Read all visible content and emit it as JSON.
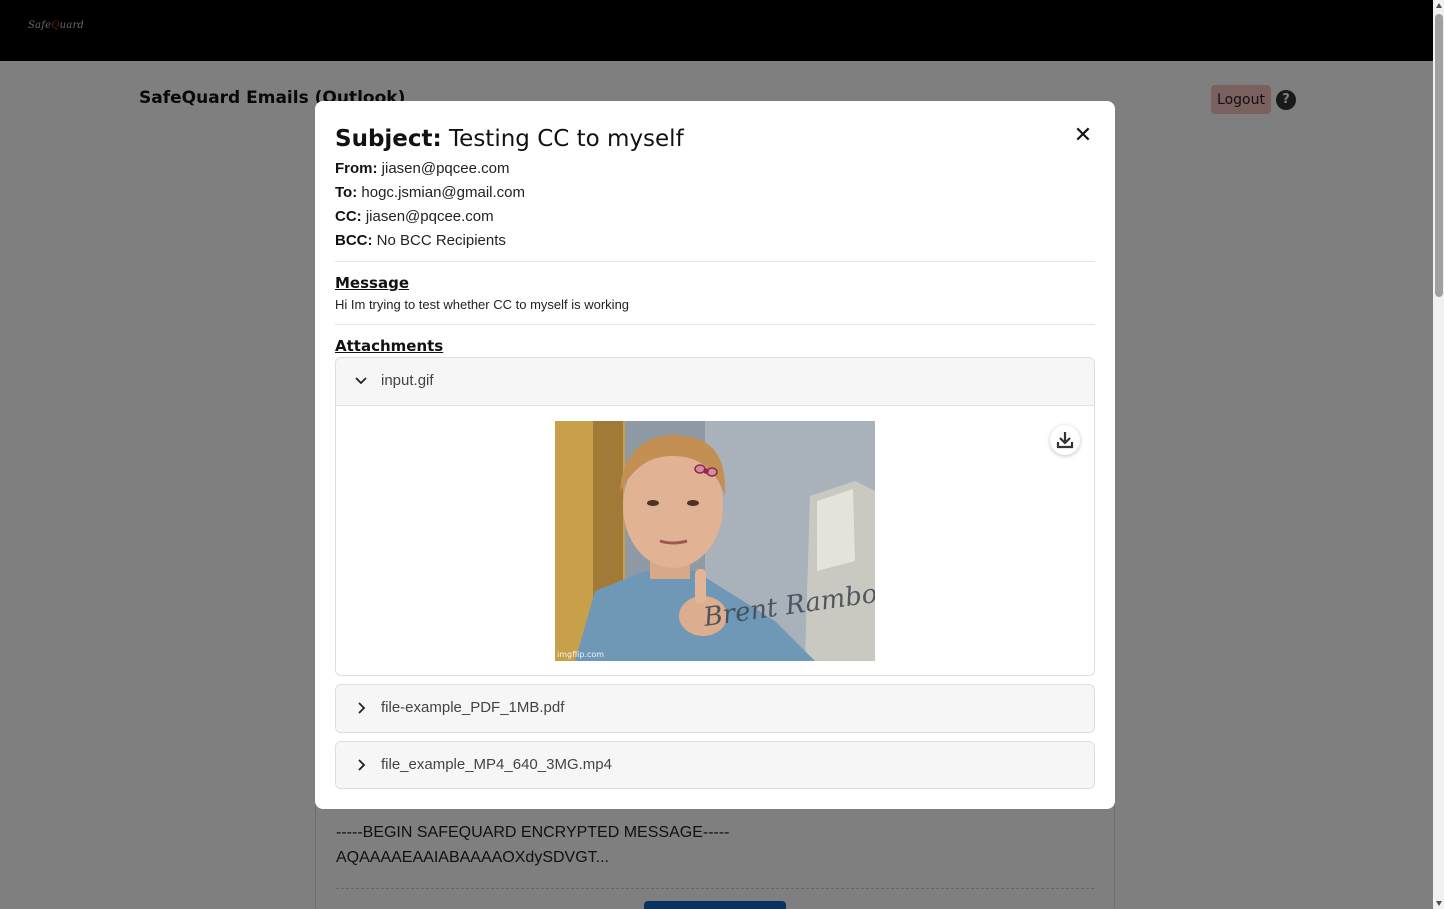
{
  "header": {
    "logo_text_pre": "Safe",
    "logo_text_q": "Q",
    "logo_text_post": "uard"
  },
  "page": {
    "title": "SafeQuard Emails (Outlook)",
    "logout_label": "Logout",
    "help_label": "?",
    "encrypted_line1": "-----BEGIN SAFEQUARD ENCRYPTED MESSAGE-----",
    "encrypted_line2": "AQAAAAEAAIABAAAAOXdySDVGT..."
  },
  "modal": {
    "close_label": "✕",
    "subject_label": "Subject:",
    "subject": "Testing CC to myself",
    "from_label": "From:",
    "from": "jiasen@pqcee.com",
    "to_label": "To:",
    "to": "hogc.jsmian@gmail.com",
    "cc_label": "CC:",
    "cc": "jiasen@pqcee.com",
    "bcc_label": "BCC:",
    "bcc": "No BCC Recipients",
    "message_title": "Message",
    "message_body": "Hi Im trying to test whether CC to myself is working",
    "attachments_title": "Attachments",
    "attachments": [
      {
        "name": "input.gif",
        "expanded": true
      },
      {
        "name": "file-example_PDF_1MB.pdf",
        "expanded": false
      },
      {
        "name": "file_example_MP4_640_3MG.mp4",
        "expanded": false
      }
    ],
    "gif_watermark": "imgflip.com",
    "gif_signature": "Brent Rambo"
  },
  "colors": {
    "accent_logout": "#f5c2c0",
    "overlay": "rgba(0,0,0,0.5)",
    "primary_button": "#1565c0"
  }
}
